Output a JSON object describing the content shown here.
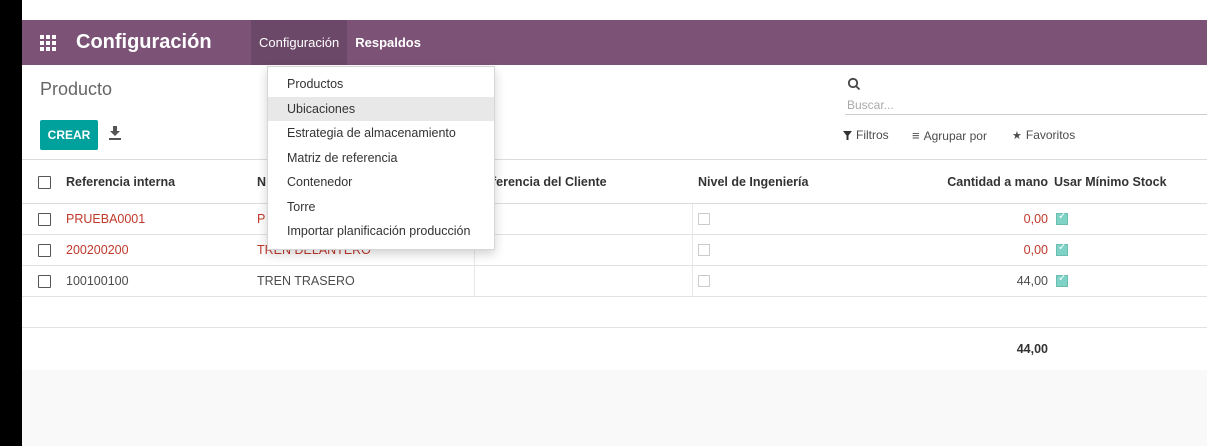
{
  "navbar": {
    "app_title": "Configuración",
    "menus": [
      "Configuración",
      "Respaldos"
    ]
  },
  "dropdown": {
    "items": [
      "Productos",
      "Ubicaciones",
      "Estrategia de almacenamiento",
      "Matriz de referencia",
      "Contenedor",
      "Torre",
      "Importar planificación producción"
    ],
    "highlighted": "Ubicaciones"
  },
  "control": {
    "breadcrumb": "Producto",
    "create_label": "CREAR",
    "search_placeholder": "Buscar...",
    "filters_label": "Filtros",
    "groupby_label": "Agrupar por",
    "favorites_label": "Favoritos"
  },
  "table": {
    "headers": {
      "ref": "Referencia interna",
      "name": "N",
      "client_ref": "ferencia del Cliente",
      "eng_level": "Nivel de Ingeniería",
      "qty": "Cantidad a mano",
      "min_stock": "Usar Mínimo Stock"
    },
    "rows": [
      {
        "ref": "PRUEBA0001",
        "name": "P",
        "qty": "0,00",
        "min_stock": true,
        "red": true
      },
      {
        "ref": "200200200",
        "name": "TREN DELANTERO",
        "qty": "0,00",
        "min_stock": true,
        "red": true
      },
      {
        "ref": "100100100",
        "name": "TREN TRASERO",
        "qty": "44,00",
        "min_stock": true,
        "red": false
      }
    ],
    "total_qty": "44,00"
  },
  "colors": {
    "navbar": "#7c5377",
    "primary_button": "#00a09d",
    "warning_text": "#c0392b"
  }
}
